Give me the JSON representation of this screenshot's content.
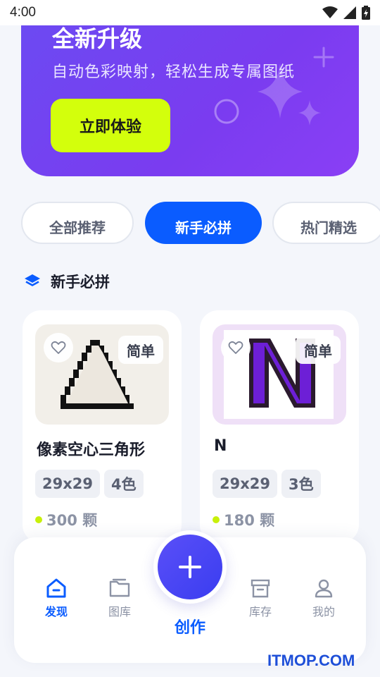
{
  "status_bar": {
    "time": "4:00"
  },
  "banner": {
    "title": "全新升级",
    "subtitle": "自动色彩映射，轻松生成专属图纸",
    "cta_label": "立即体验"
  },
  "tabs": [
    {
      "label": "全部推荐",
      "active": false
    },
    {
      "label": "新手必拼",
      "active": true
    },
    {
      "label": "热门精选",
      "active": false
    }
  ],
  "section": {
    "title": "新手必拼"
  },
  "cards": [
    {
      "title": "像素空心三角形",
      "difficulty": "简单",
      "size": "29x29",
      "colors": "4色",
      "count": "300 颗"
    },
    {
      "title": "N",
      "difficulty": "简单",
      "size": "29x29",
      "colors": "3色",
      "count": "180 颗"
    }
  ],
  "bottom_nav": {
    "items": [
      {
        "label": "发现",
        "icon": "home-icon",
        "active": true
      },
      {
        "label": "图库",
        "icon": "folder-icon",
        "active": false
      },
      {
        "label": "库存",
        "icon": "archive-icon",
        "active": false
      },
      {
        "label": "我的",
        "icon": "user-icon",
        "active": false
      }
    ],
    "create_label": "创作"
  },
  "watermark": "ITMOP.COM",
  "colors": {
    "accent": "#0a5cff",
    "banner": "#7a3cf0",
    "cta": "#d3ff0c",
    "count_dot": "#c8f00a"
  }
}
